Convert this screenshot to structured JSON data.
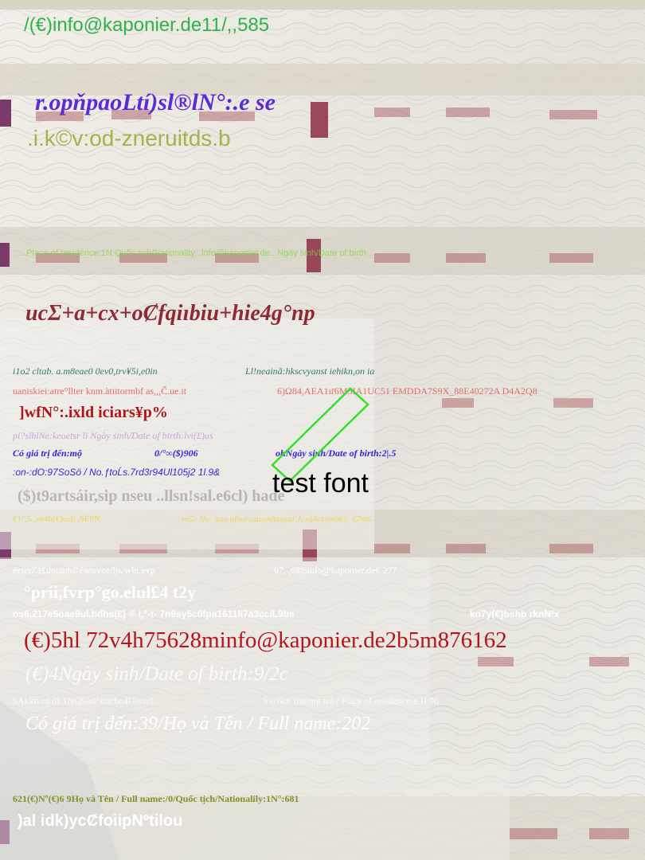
{
  "colors": {
    "green": "#2fb34a",
    "violet": "#5a2bd6",
    "olive": "#9aa33a",
    "lime": "#7fdc3a",
    "maroon": "#8e2a34",
    "teal": "#2c7a6a",
    "salmon": "#e06060",
    "crimson": "#b0141a",
    "lilac": "#c9a3e6",
    "blue": "#3a22d8",
    "grey": "#b9b6ad",
    "yellow": "#e8d94a",
    "white": "#ffffff",
    "darkred": "#b4151e",
    "moss": "#8a8f2a"
  },
  "lines": {
    "l1": "/(€)info@kaponier.de11/,,585",
    "l2": "r.opňpaoLtí)sl®lN°:.e se",
    "l3": ".i.k©v:od-zneruitds.b",
    "l4": "...Place of residence:1N Quốc tịch/Nationality...info@kaponier.de...Ngày sinh/Date of birth...",
    "l5": "ucΣ+a+cx+oȻfqiɪbiu+hie4g°np",
    "l6a": "i1o2 cltab. a.m8eae0 0ev0,trv¥5i,e0in",
    "l6b": "Ll!neainã:hkscvyanst iehikn,on ia",
    "l7a": "uaniskiei:atre°llter knm.àtiitormbf as,,,Č.ue.it",
    "l7b": "6)Ω84,AEA1ır̄6M5IA1UC51 EMDDA7S9X_88E40272A D4A2Q8",
    "l8": "]wfN°:.ixld iciars¥p%",
    "l9": "pi?slblNe:keoetsr li Ngày sinh/Date of birth:lvi(£)as",
    "l10a": "Có giá trị đến:mộ",
    "l10b": "0/°∞($)906",
    "l10c": "ohNgày sinh/Date of birth:2|.5",
    "l11": ":on-:dO:97SoSö / No.ƒtoĹs.7rd3r94Ul105j2 1l.9&",
    "l12": "test font",
    "l13": "($)t9artsáir,sip nseu ..llsn!sal.e6cl) hade",
    "l14a": "€1°,5 ,ee46(€)uz6 ,9Ě9N",
    "l14b": "nő2/ No. |tau ulhursauwnhaosal Jcxq4czymhk|i. €7m6",
    "l15a": "éeterZà£doianh©éansvoe/ljs/wln.evp",
    "l15b": "67, ,69|6info@kaponier.de€ 277",
    "l16": "°príi,fvrp°go.elul£4 t2y",
    "l17a": "os6,217e5oae9ul.hdhs(£) ® i,°-t- 7n9sy5c0fpa1611li7a3cciL9bs",
    "l17b": "ko7y(€}bshb  rknN²x",
    "l18": "(€)5hl 72v4h75628minfo@kaponier.de2b5m876162",
    "l19": "(€)4Ngày sinh/Date of birth:9/2c",
    "l20a": "9Akkti.rú đI 1NQSoii°itacbn4HtsvsL",
    "l20b": "YsrNơi thường trú / Place of residence:e.H.9h",
    "l21": "Có giá trị đến:39/Họ và Tên / Full name:202",
    "l22": "621(€)Nº(€)6   9Họ và Tên / Full name:/0/Quốc tịch/Nationalily:1N°:681",
    "l23": ")al idk)ycȻfoiipNºtilou"
  }
}
